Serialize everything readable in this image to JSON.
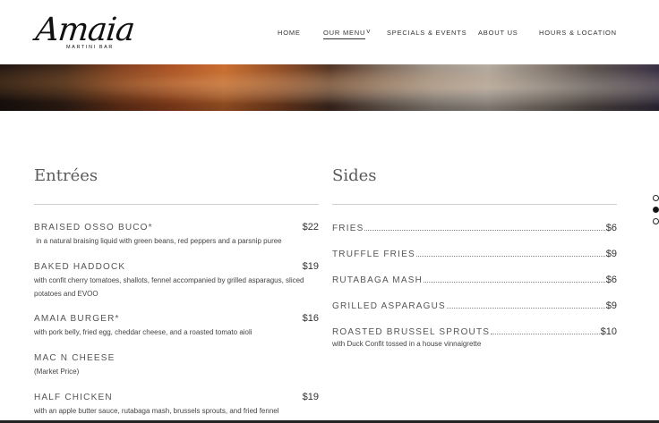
{
  "brand": {
    "logo_script": "Amaia",
    "logo_sub": "MARTINI BAR"
  },
  "nav": {
    "items": [
      {
        "label": "HOME"
      },
      {
        "label": "OUR MENU"
      },
      {
        "label": "SPECIALS & EVENTS"
      },
      {
        "label": "ABOUT US"
      },
      {
        "label": "HOURS & LOCATION"
      }
    ],
    "active": "OUR MENU"
  },
  "entrees": {
    "title": "Entrées",
    "items": [
      {
        "name": "BRAISED OSSO BUCO*",
        "price": "$22",
        "desc": " in a natural braising liquid with green beans, red peppers and a parsnip puree"
      },
      {
        "name": "BAKED HADDOCK",
        "price": "$19",
        "desc": "with confit cherry tomatoes, shallots, fennel accompanied by grilled asparagus, sliced potatoes and EVOO"
      },
      {
        "name": "AMAIA BURGER*",
        "price": "$16",
        "desc": "with pork belly, fried egg, cheddar cheese, and a roasted tomato aioli"
      },
      {
        "name": "MAC N CHEESE",
        "price": "",
        "desc": "(Market Price)"
      },
      {
        "name": "HALF CHICKEN",
        "price": "$19",
        "desc": "with an apple butter sauce, rutabaga mash, brussels sprouts, and fried fennel"
      }
    ]
  },
  "sides": {
    "title": "Sides",
    "items": [
      {
        "name": "FRIES",
        "price": "$6",
        "desc": ""
      },
      {
        "name": "TRUFFLE FRIES",
        "price": "$9",
        "desc": ""
      },
      {
        "name": "RUTABAGA MASH",
        "price": "$6",
        "desc": ""
      },
      {
        "name": "GRILLED ASPARAGUS",
        "price": "$9",
        "desc": ""
      },
      {
        "name": "ROASTED BRUSSEL SPROUTS",
        "price": "$10",
        "desc": "with Duck Confit tossed in a house vinnaigrette"
      }
    ]
  },
  "page_dots": {
    "count": 3,
    "active_index": 1
  }
}
